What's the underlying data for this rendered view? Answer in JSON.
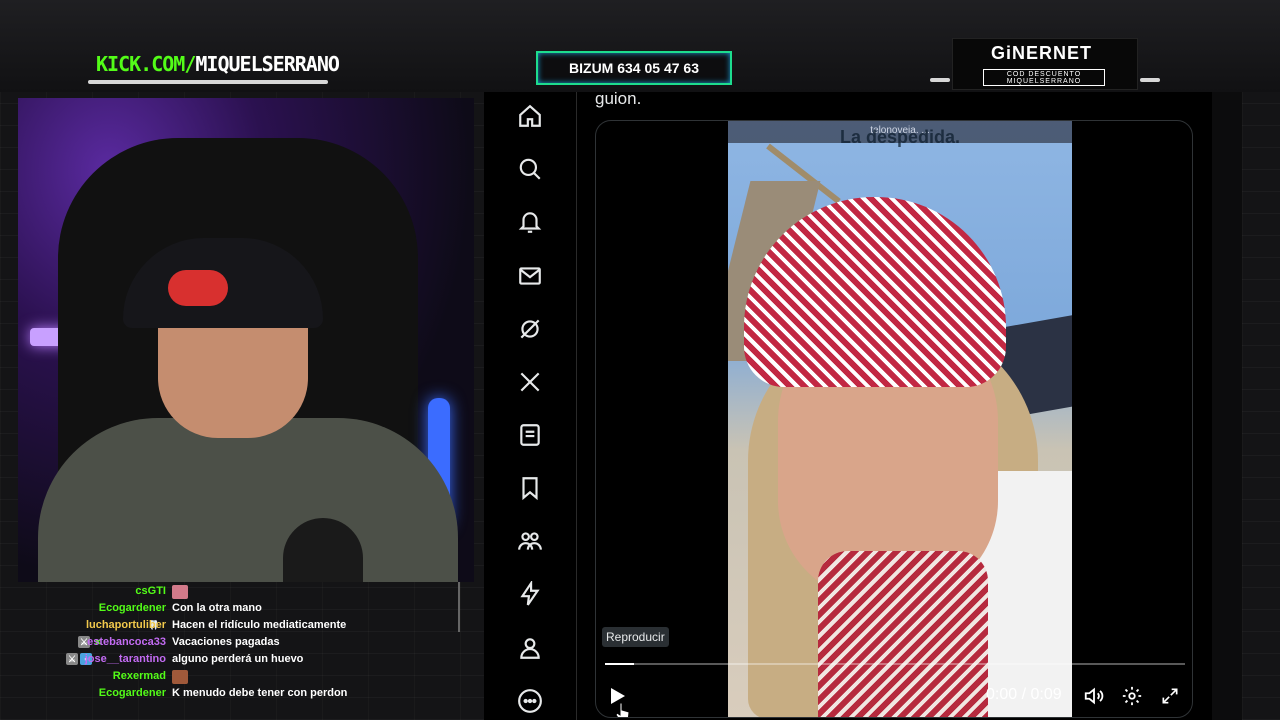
{
  "overlay": {
    "kick_url_prefix": "KICK.COM/",
    "kick_url_name": "MIQUELSERRANO",
    "bizum": "BIZUM 634 05 47 63",
    "sponsor_logo": "GiNERNET",
    "sponsor_code": "COD DESCUENTO MIQUELSERRANO"
  },
  "chat": [
    {
      "user": "csGTI",
      "color": "#53fc18",
      "message": "",
      "badges": [],
      "emote": "#d27a8a"
    },
    {
      "user": "Ecogardener",
      "color": "#53fc18",
      "message": "Con la otra mano",
      "badges": []
    },
    {
      "user": "luchaportuliber",
      "color": "#f2c94c",
      "message": "Hacen el ridículo mediaticamente",
      "badges": [
        "tooth"
      ]
    },
    {
      "user": "estebancoca33",
      "color": "#c26bf2",
      "message": "Vacaciones pagadas",
      "badges": [
        "mod",
        "x"
      ]
    },
    {
      "user": "jose__tarantino",
      "color": "#c26bf2",
      "message": "alguno perderá un huevo",
      "badges": [
        "mod",
        "sub"
      ]
    },
    {
      "user": "Rexermad",
      "color": "#53fc18",
      "message": "",
      "badges": [],
      "emote": "#a0593a"
    },
    {
      "user": "Ecogardener",
      "color": "#53fc18",
      "message": "K menudo debe tener con perdon",
      "badges": []
    }
  ],
  "twitter": {
    "nav": [
      "home-icon",
      "search-icon",
      "bell-icon",
      "mail-icon",
      "grok-icon",
      "x-premium-icon",
      "lists-icon",
      "bookmark-icon",
      "communities-icon",
      "verified-orgs-icon",
      "profile-icon",
      "more-icon"
    ],
    "tweet_text_fragment": "guion.",
    "video": {
      "top_caption": "La despedida.",
      "top_banner": "telonoveia. ...",
      "tooltip": "Reproducir",
      "time": "0:00 / 0:09",
      "progress": 0.05
    }
  },
  "colors": {
    "kick_green": "#53fc18",
    "bizum_border": "#1ddc8e",
    "twitter_bg": "#000000"
  }
}
